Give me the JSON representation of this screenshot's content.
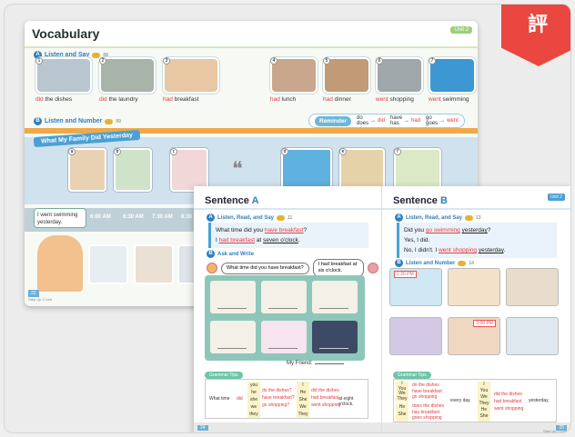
{
  "ribbon": {
    "text": "評"
  },
  "vocab": {
    "title": "Vocabulary",
    "unit_badge": "Unit 2",
    "section_a": {
      "dot": "A",
      "label": "Listen and Say",
      "audio": "08"
    },
    "section_b": {
      "dot": "B",
      "label": "Listen and Number",
      "audio": "09"
    },
    "items": [
      {
        "num": "1",
        "verb": "did",
        "rest": " the dishes",
        "color": "#b9c6cf"
      },
      {
        "num": "2",
        "verb": "did",
        "rest": " the laundry",
        "color": "#a8b4a9"
      },
      {
        "num": "3",
        "verb": "had",
        "rest": " breakfast",
        "color": "#e8c7a4"
      },
      {
        "num": "4",
        "verb": "had",
        "rest": " lunch",
        "color": "#c8a78d"
      },
      {
        "num": "5",
        "verb": "had",
        "rest": " dinner",
        "color": "#c19a76"
      },
      {
        "num": "6",
        "verb": "went",
        "rest": " shopping",
        "color": "#9fa7ab"
      },
      {
        "num": "7",
        "verb": "went",
        "rest": " swimming",
        "color": "#3c97d2"
      }
    ],
    "reminder": {
      "label": "Reminder",
      "pairs": [
        {
          "base": "do\ndoes",
          "past": "did"
        },
        {
          "base": "have\nhas",
          "past": "had"
        },
        {
          "base": "go\ngoes",
          "past": "went"
        }
      ]
    },
    "family_title": "What My Family Did Yesterday",
    "family_pics": [
      "a",
      "b",
      "c",
      "d",
      "e",
      "f"
    ],
    "bubble": "I went swimming\nyesterday.",
    "times": [
      "6:00 AM",
      "6:30 AM",
      "7:30 AM",
      "8:30 AM"
    ],
    "page_left": "22",
    "page_left_sub": "Step Up 2 Unit"
  },
  "sentence_a": {
    "title_prefix": "Sentence ",
    "title_letter": "A",
    "section_a": {
      "dot": "A",
      "label": "Listen, Read, and Say",
      "audio": "11"
    },
    "box": {
      "line1_a": "What time did you ",
      "line1_b": "have breakfast",
      "line1_c": "?",
      "line2_a": "I ",
      "line2_b": "had breakfast",
      "line2_c": " at ",
      "line2_d": "seven o'clock",
      "line2_e": "."
    },
    "section_b": {
      "dot": "B",
      "label": "Ask and Write"
    },
    "q": "What time did you have breakfast?",
    "a": "I had breakfast at six o'clock.",
    "friend": "My Friend:",
    "tips": "Grammar Tips",
    "table": {
      "col1": "What time",
      "col2": "did",
      "pronouns": [
        "you",
        "he",
        "she",
        "we",
        "they"
      ],
      "verbs": [
        "do the dishes?",
        "have breakfast?",
        "go shopping?"
      ],
      "subjects": [
        "I",
        "He",
        "She",
        "We",
        "They"
      ],
      "past": [
        "did the dishes",
        "had breakfast",
        "went shopping"
      ],
      "end": "at eight o'clock."
    },
    "page": "24"
  },
  "sentence_b": {
    "title_prefix": "Sentence ",
    "title_letter": "B",
    "unit": "Unit 2",
    "section_a": {
      "dot": "A",
      "label": "Listen, Read, and Say",
      "audio": "13"
    },
    "box": {
      "line1_a": "Did you ",
      "line1_b": "go swimming",
      "line1_c": " ",
      "line1_d": "yesterday",
      "line1_e": "?",
      "line2": "Yes, I did.",
      "line3_a": "No, I didn't. I ",
      "line3_b": "went shopping",
      "line3_c": " ",
      "line3_d": "yesterday",
      "line3_e": "."
    },
    "section_b": {
      "dot": "B",
      "label": "Listen and Number",
      "audio": "14"
    },
    "times": [
      "1:30 PM",
      "3:00 PM"
    ],
    "tips": "Grammar Tips",
    "table": {
      "subj1": [
        "I",
        "You",
        "We",
        "They"
      ],
      "verb1": [
        "do the dishes",
        "have breakfast",
        "go shopping"
      ],
      "subj2": [
        "He",
        "She"
      ],
      "verb2": [
        "does the dishes",
        "has breakfast",
        "goes shopping"
      ],
      "mid": "every day.",
      "subj3": [
        "I",
        "You",
        "We",
        "They",
        "He",
        "She"
      ],
      "past": [
        "did the dishes",
        "had breakfast",
        "went shopping"
      ],
      "end": "yesterday."
    },
    "page": "25",
    "page_sub": "Step Up 2 Unit"
  }
}
